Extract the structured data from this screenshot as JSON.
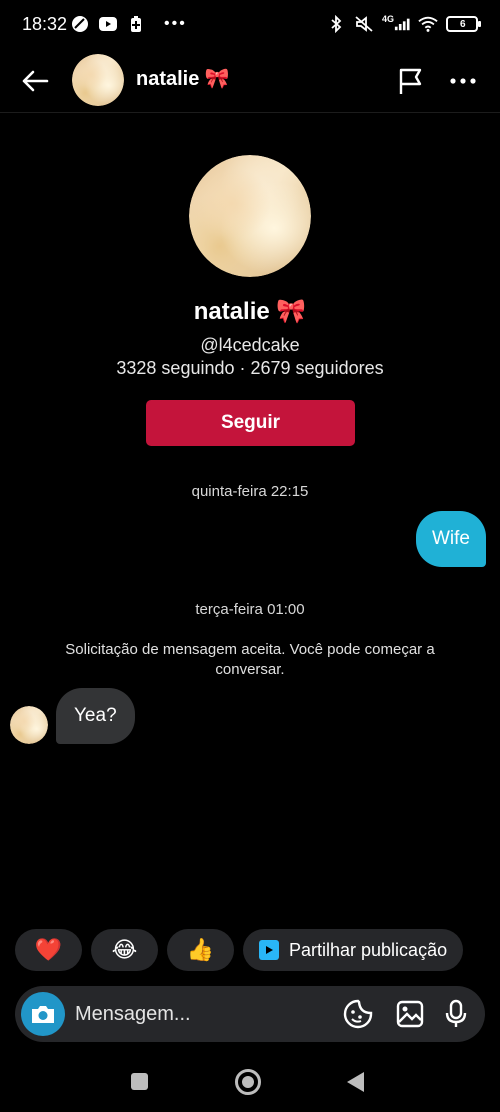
{
  "status_bar": {
    "time": "18:32",
    "network": "4G",
    "battery": "6",
    "battery_color": "#e53935"
  },
  "header": {
    "contact_name": "natalie 🎀",
    "icons": [
      "back-arrow-icon",
      "flag-icon",
      "more-options-icon"
    ]
  },
  "profile": {
    "name": "natalie 🎀",
    "handle": "@l4cedcake",
    "stats": "3328 seguindo · 2679 seguidores",
    "follow_label": "Seguir",
    "follow_color": "#c4143b"
  },
  "conversation": {
    "timestamp_1": "quinta-feira 22:15",
    "outgoing_message": "Wife",
    "outgoing_color": "#20b1d6",
    "timestamp_2": "terça-feira 01:00",
    "system_message": "Solicitação de mensagem aceita. Você pode começar a conversar.",
    "incoming_message": "Yea?",
    "incoming_color": "#333436"
  },
  "quick_replies": {
    "heart": "❤️",
    "laugh": "😂",
    "thumbs_up": "👍",
    "share_label": "Partilhar publicação"
  },
  "composer": {
    "placeholder": "Mensagem...",
    "icons": [
      "camera-icon",
      "sticker-icon",
      "gallery-icon",
      "microphone-icon"
    ]
  }
}
